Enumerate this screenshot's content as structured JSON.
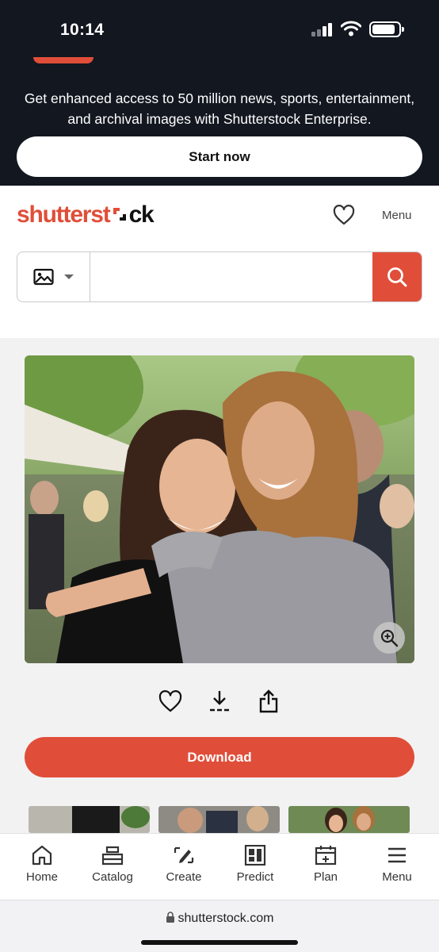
{
  "status_bar": {
    "time": "10:14"
  },
  "promo": {
    "text_line1": "Get enhanced access to 50 million news, sports, entertainment,",
    "text_line2": "and archival images with Shutterstock Enterprise.",
    "button_label": "Start now"
  },
  "header": {
    "logo_part1": "shutterst",
    "logo_part2": "ck",
    "menu_label": "Menu"
  },
  "search": {
    "value": "",
    "placeholder": "",
    "type_icon": "image-icon"
  },
  "photo": {
    "zoom_icon": "zoom-in-icon"
  },
  "actions": {
    "icons": [
      "heart-icon",
      "download-icon",
      "share-icon"
    ]
  },
  "download_button": {
    "label": "Download"
  },
  "tabbar": {
    "items": [
      {
        "label": "Home",
        "icon": "home-icon"
      },
      {
        "label": "Catalog",
        "icon": "catalog-icon"
      },
      {
        "label": "Create",
        "icon": "create-icon"
      },
      {
        "label": "Predict",
        "icon": "predict-icon"
      },
      {
        "label": "Plan",
        "icon": "calendar-icon"
      },
      {
        "label": "Menu",
        "icon": "hamburger-icon"
      }
    ]
  },
  "browser": {
    "url": "shutterstock.com"
  },
  "colors": {
    "brand": "#e04e39",
    "banner": "#121720"
  }
}
